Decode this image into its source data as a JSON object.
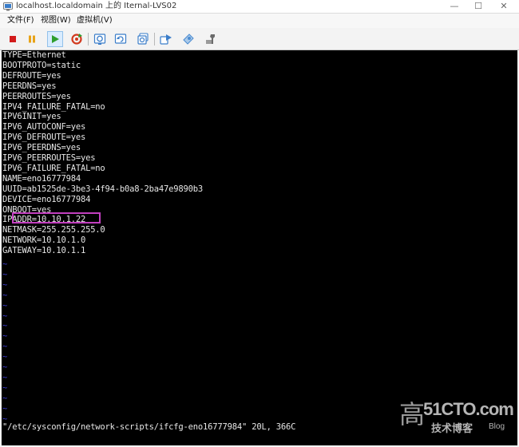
{
  "window": {
    "title": "localhost.localdomain 上的 Iternal-LVS02",
    "minimize": "—",
    "maximize": "☐",
    "close": "✕"
  },
  "menu": [
    "文件(F)",
    "视图(W)",
    "虚拟机(V)"
  ],
  "toolbar": {
    "buttons": [
      {
        "name": "stop-button",
        "icon": "stop-icon",
        "color": "#d21b1b"
      },
      {
        "name": "pause-button",
        "icon": "pause-icon",
        "color": "#e8a317"
      },
      {
        "name": "play-button",
        "icon": "play-icon",
        "color": "#2e9e2e"
      },
      {
        "name": "refresh-button",
        "icon": "refresh-icon",
        "color": "#d23a1f"
      },
      {
        "name": "snapshot-button",
        "icon": "snapshot-icon",
        "color": "#3a7dc9"
      },
      {
        "name": "revert-snapshot-button",
        "icon": "revert-snapshot-icon",
        "color": "#3a7dc9"
      },
      {
        "name": "manage-snapshots-button",
        "icon": "manage-snapshots-icon",
        "color": "#3a7dc9"
      },
      {
        "name": "send-keys-button",
        "icon": "send-keys-icon",
        "color": "#3a7dc9"
      },
      {
        "name": "settings-button",
        "icon": "settings-icon",
        "color": "#4a8bd0"
      },
      {
        "name": "tools-button",
        "icon": "tools-icon",
        "color": "#6b6b6b"
      }
    ]
  },
  "console": {
    "lines": [
      "TYPE=Ethernet",
      "BOOTPROTO=static",
      "DEFROUTE=yes",
      "PEERDNS=yes",
      "PEERROUTES=yes",
      "IPV4_FAILURE_FATAL=no",
      "IPV6INIT=yes",
      "IPV6_AUTOCONF=yes",
      "IPV6_DEFROUTE=yes",
      "IPV6_PEERDNS=yes",
      "IPV6_PEERROUTES=yes",
      "IPV6_FAILURE_FATAL=no",
      "NAME=eno16777984",
      "UUID=ab1525de-3be3-4f94-b0a8-2ba47e9890b3",
      "DEVICE=eno16777984",
      "ONBOOT=yes",
      "IPADDR=10.10.1.22",
      "NETMASK=255.255.255.0",
      "NETWORK=10.10.1.0",
      "GATEWAY=10.10.1.1"
    ],
    "tilde": "~",
    "tilde_count": 16,
    "status": "\"/etc/sysconfig/network-scripts/ifcfg-eno16777984\" 20L, 366C",
    "highlight_color": "#c23fbf"
  },
  "watermark": {
    "char": "高",
    "site": "51CTO.com",
    "tag": "技术博客",
    "blog": "Blog"
  }
}
